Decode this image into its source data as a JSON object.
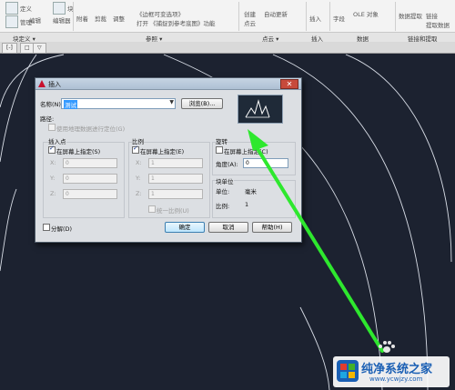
{
  "ribbon": {
    "tools": [
      "定义",
      "管理",
      "编辑",
      "块",
      "编辑器",
      "附着",
      "剪裁",
      "调整",
      "《边框可变选项》",
      "打开",
      "《捕捉到参考底图》功能",
      "创建",
      "点云",
      "自动更新",
      "插入",
      "字段",
      "OLE 对象",
      "数据提取",
      "链接",
      "提取数据"
    ],
    "panels": [
      "块定义 ▾",
      "参照 ▾",
      "点云 ▾",
      "插入",
      "数据",
      "链接和提取"
    ]
  },
  "tabs": [
    "[-]",
    "□",
    "▽"
  ],
  "dialog": {
    "title": "插入",
    "close": "✕",
    "name_label": "名称(N):",
    "name_value": "测试",
    "browse": "浏览(B)...",
    "path_label": "路径:",
    "geo_label": "使用地理数据进行定位(G)",
    "insert_point": {
      "title": "插入点",
      "on_screen": "在屏幕上指定(S)",
      "x": "X:",
      "y": "Y:",
      "z": "Z:",
      "x_val": "0",
      "y_val": "0",
      "z_val": "0"
    },
    "scale": {
      "title": "比例",
      "on_screen": "在屏幕上指定(E)",
      "x": "X:",
      "y": "Y:",
      "z": "Z:",
      "x_val": "1",
      "y_val": "1",
      "z_val": "1",
      "uniform": "统一比例(U)"
    },
    "rotation": {
      "title": "旋转",
      "on_screen": "在屏幕上指定(C)",
      "angle_label": "角度(A):",
      "angle_val": "0"
    },
    "block_unit": {
      "title": "块单位",
      "unit_label": "单位:",
      "unit_val": "毫米",
      "factor_label": "比例:",
      "factor_val": "1"
    },
    "explode": "分解(D)",
    "ok": "确定",
    "cancel": "取消",
    "help": "帮助(H)"
  },
  "watermark": {
    "text_cn": "纯净系统之家",
    "url": "www.ycwjzy.com"
  },
  "colors": {
    "canvas": "#1c2230",
    "arrow": "#2ee82e",
    "preview_bg": "#1f2a38"
  }
}
